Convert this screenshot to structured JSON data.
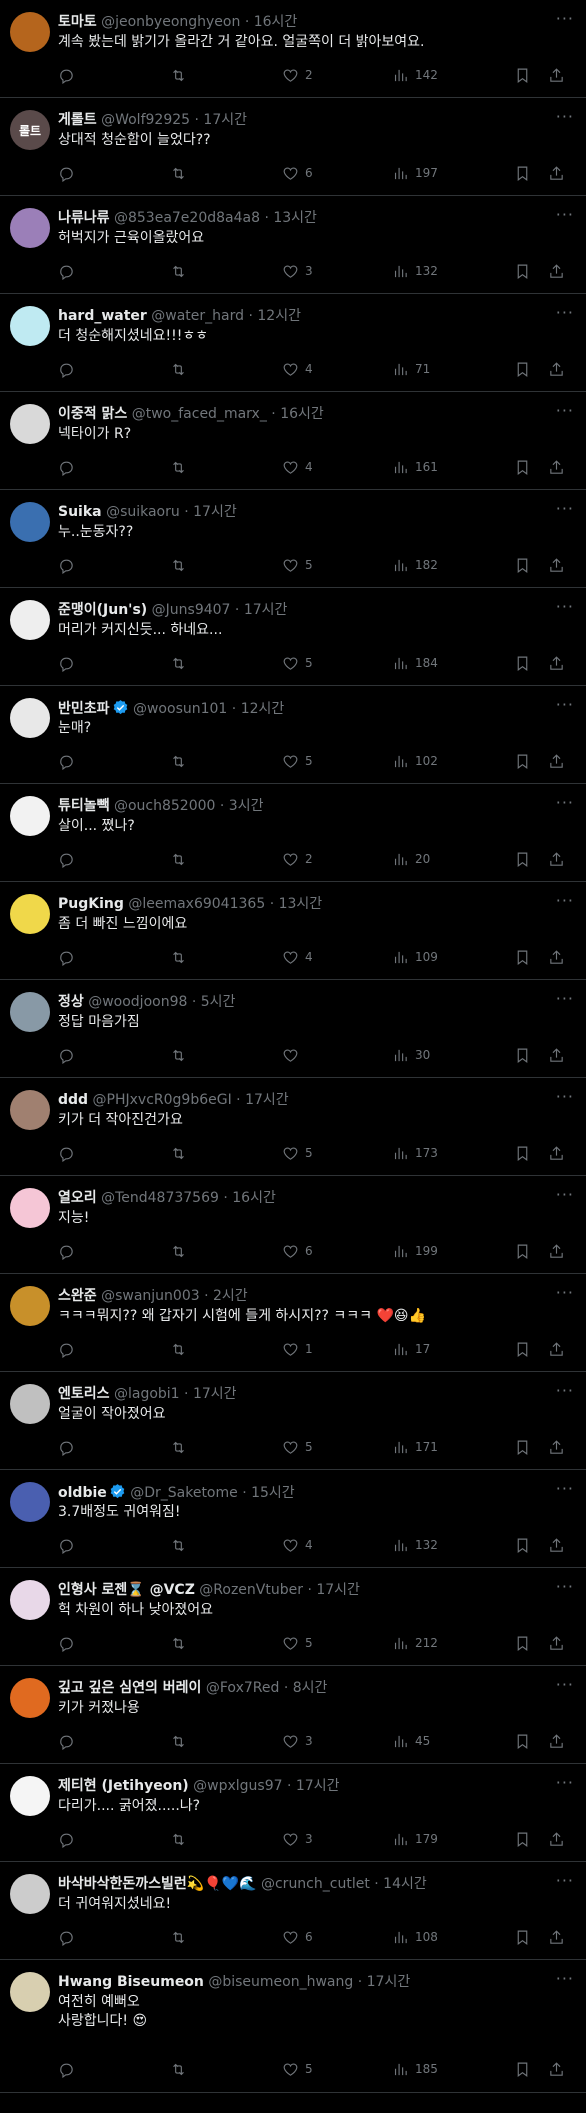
{
  "tweets": [
    {
      "name": "토마토",
      "handle": "@jeonbyeonghyeon",
      "time": "16시간",
      "text": "계속 봤는데 밝기가 올라간 거 같아요. 얼굴쪽이 더 밝아보여요.",
      "reply": "",
      "retweet": "",
      "like": "2",
      "views": "142",
      "avatar_color": "#b5651d",
      "verified": false
    },
    {
      "name": "게롤트",
      "handle": "@Wolf92925",
      "time": "17시간",
      "text": "상대적 청순함이 늘었다??",
      "reply": "",
      "retweet": "",
      "like": "6",
      "views": "197",
      "avatar_color": "#5a4a4a",
      "verified": false
    },
    {
      "name": "나류나류",
      "handle": "@853ea7e20d8a4a8",
      "time": "13시간",
      "text": "허벅지가 근육이올랐어요",
      "reply": "",
      "retweet": "",
      "like": "3",
      "views": "132",
      "avatar_color": "#9b7fb8",
      "verified": false
    },
    {
      "name": "hard_water",
      "handle": "@water_hard",
      "time": "12시간",
      "text": "더 청순해지셨네요!!!ㅎㅎ",
      "reply": "",
      "retweet": "",
      "like": "4",
      "views": "71",
      "avatar_color": "#bfeaf2",
      "verified": false
    },
    {
      "name": "이중적 맑스",
      "handle": "@two_faced_marx_",
      "time": "16시간",
      "text": "넥타이가 R?",
      "reply": "",
      "retweet": "",
      "like": "4",
      "views": "161",
      "avatar_color": "#d9d9d9",
      "verified": false
    },
    {
      "name": "Suika",
      "handle": "@suikaoru",
      "time": "17시간",
      "text": "누..눈동자??",
      "reply": "",
      "retweet": "",
      "like": "5",
      "views": "182",
      "avatar_color": "#3a6fb0",
      "verified": false
    },
    {
      "name": "준맹이(Jun's)",
      "handle": "@Juns9407",
      "time": "17시간",
      "text": "머리가 커지신듯... 하네요...",
      "reply": "",
      "retweet": "",
      "like": "5",
      "views": "184",
      "avatar_color": "#eeeeee",
      "verified": false
    },
    {
      "name": "반민초파",
      "handle": "@woosun101",
      "time": "12시간",
      "text": "눈매?",
      "reply": "",
      "retweet": "",
      "like": "5",
      "views": "102",
      "avatar_color": "#e8e8e8",
      "verified": true
    },
    {
      "name": "튜티놀빽",
      "handle": "@ouch852000",
      "time": "3시간",
      "text": "살이... 쪘나?",
      "reply": "",
      "retweet": "",
      "like": "2",
      "views": "20",
      "avatar_color": "#f2f2f2",
      "verified": false
    },
    {
      "name": "PugKing",
      "handle": "@leemax69041365",
      "time": "13시간",
      "text": "좀 더 빠진 느낌이에요",
      "reply": "",
      "retweet": "",
      "like": "4",
      "views": "109",
      "avatar_color": "#f0d84a",
      "verified": false
    },
    {
      "name": "정상",
      "handle": "@woodjoon98",
      "time": "5시간",
      "text": "정답 마음가짐",
      "reply": "",
      "retweet": "",
      "like": "",
      "views": "30",
      "avatar_color": "#8899a6",
      "verified": false
    },
    {
      "name": "ddd",
      "handle": "@PHJxvcR0g9b6eGI",
      "time": "17시간",
      "text": "키가 더 작아진건가요",
      "reply": "",
      "retweet": "",
      "like": "5",
      "views": "173",
      "avatar_color": "#a08070",
      "verified": false
    },
    {
      "name": "열오리",
      "handle": "@Tend48737569",
      "time": "16시간",
      "text": "지능!",
      "reply": "",
      "retweet": "",
      "like": "6",
      "views": "199",
      "avatar_color": "#f5c6d6",
      "verified": false
    },
    {
      "name": "스완준",
      "handle": "@swanjun003",
      "time": "2시간",
      "text": "ㅋㅋㅋ뭐지?? 왜 갑자기 시험에 들게 하시지?? ㅋㅋㅋ ❤️😆👍",
      "reply": "",
      "retweet": "",
      "like": "1",
      "views": "17",
      "avatar_color": "#c8902a",
      "verified": false
    },
    {
      "name": "엔토리스",
      "handle": "@lagobi1",
      "time": "17시간",
      "text": "얼굴이 작아졌어요",
      "reply": "",
      "retweet": "",
      "like": "5",
      "views": "171",
      "avatar_color": "#c0c0c0",
      "verified": false
    },
    {
      "name": "oldbie",
      "handle": "@Dr_Saketome",
      "time": "15시간",
      "text": "3.7배정도 귀여워짐!",
      "reply": "",
      "retweet": "",
      "like": "4",
      "views": "132",
      "avatar_color": "#4a5fb0",
      "verified": true
    },
    {
      "name": "인형사 로젠⌛ @VCZ",
      "handle": "@RozenVtuber",
      "time": "17시간",
      "text": "헉 차원이 하나 낮아졌어요",
      "reply": "",
      "retweet": "",
      "like": "5",
      "views": "212",
      "avatar_color": "#e8d8e8",
      "verified": false
    },
    {
      "name": "깊고 깊은 심연의 버레이",
      "handle": "@Fox7Red",
      "time": "8시간",
      "text": "키가 커졌나용",
      "reply": "",
      "retweet": "",
      "like": "3",
      "views": "45",
      "avatar_color": "#e06a20",
      "verified": false
    },
    {
      "name": "제티현 (Jetihyeon)",
      "handle": "@wpxlgus97",
      "time": "17시간",
      "text": "다리가.... 굵어졌.....나?",
      "reply": "",
      "retweet": "",
      "like": "3",
      "views": "179",
      "avatar_color": "#f5f5f5",
      "verified": false
    },
    {
      "name": "바삭바삭한돈까스빌런💫🎈💙🌊",
      "handle": "@crunch_cutlet",
      "time": "14시간",
      "text": "더 귀여워지셨네요!",
      "reply": "",
      "retweet": "",
      "like": "6",
      "views": "108",
      "avatar_color": "#cccccc",
      "verified": false
    },
    {
      "name": "Hwang Biseumeon",
      "handle": "@biseumeon_hwang",
      "time": "17시간",
      "text": "여전히 예뻐오\n사랑합니다! 😍",
      "reply": "",
      "retweet": "",
      "like": "5",
      "views": "185",
      "avatar_color": "#d8cfb0",
      "verified": false
    }
  ],
  "avatars": {
    "avatar_2_text": "롤트"
  },
  "colors": {
    "background": "#000000",
    "divider": "#2f3336",
    "text": "#e7e9ea",
    "muted": "#71767b",
    "verified": "#1d9bf0"
  }
}
